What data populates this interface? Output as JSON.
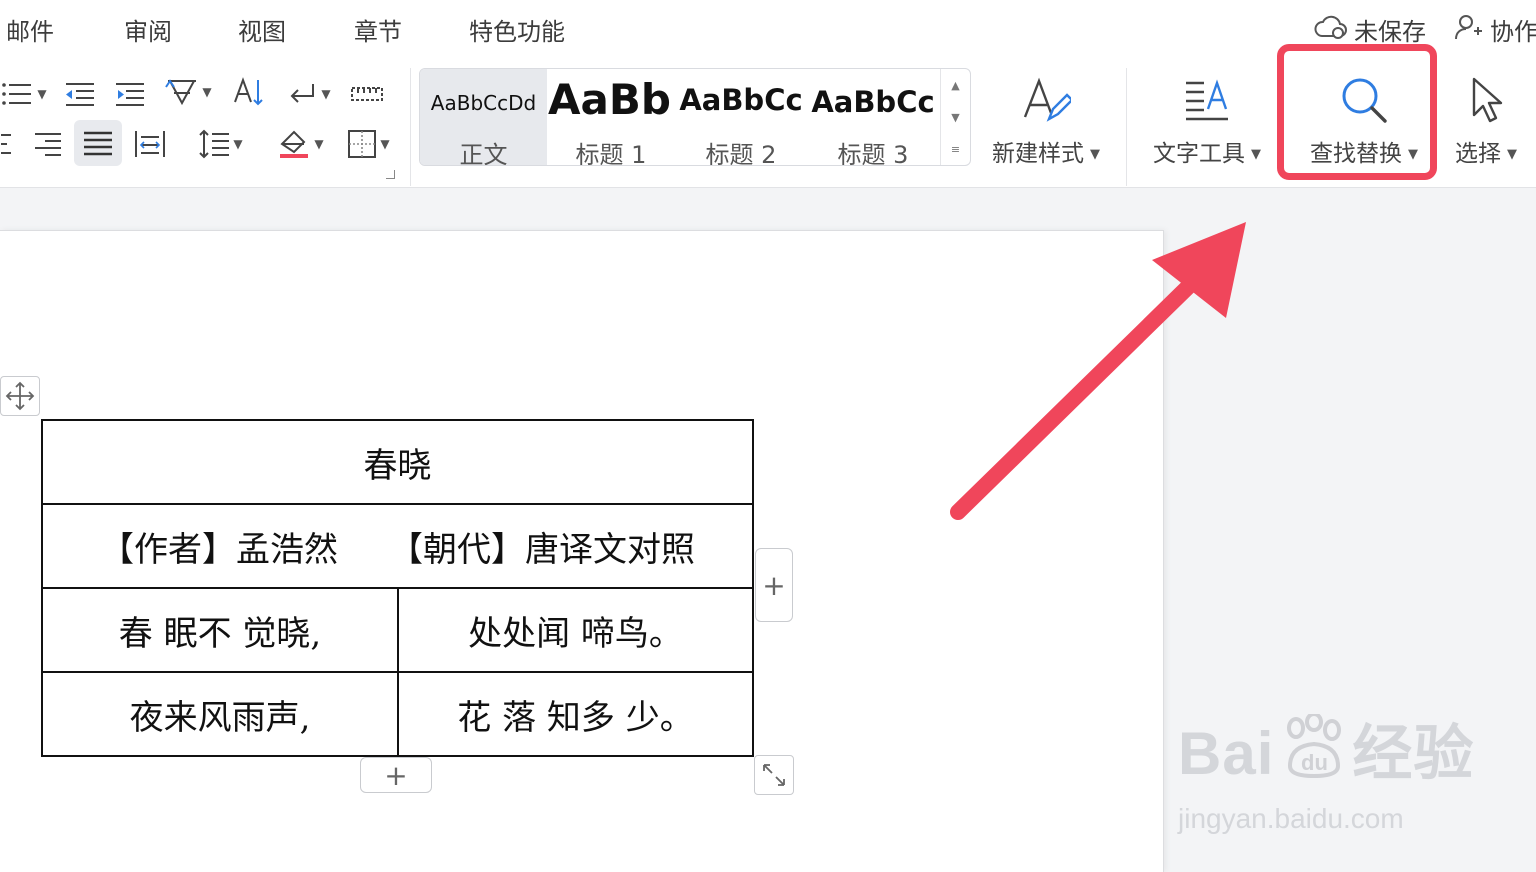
{
  "menu": {
    "tabs": [
      "邮件",
      "审阅",
      "视图",
      "章节",
      "特色功能"
    ],
    "unsaved": "未保存",
    "collab": "协作"
  },
  "styles": {
    "items": [
      {
        "preview": "AaBbCcDd",
        "label": "正文"
      },
      {
        "preview": "AaBb(",
        "label": "标题 1"
      },
      {
        "preview": "AaBbCc",
        "label": "标题 2"
      },
      {
        "preview": "AaBbCc",
        "label": "标题 3"
      }
    ]
  },
  "toolbar": {
    "new_style": "新建样式",
    "text_tools": "文字工具",
    "find_replace": "查找替换",
    "select": "选择"
  },
  "table": {
    "title": "春晓",
    "meta": "【作者】孟浩然　　【朝代】唐译文对照",
    "rows": [
      [
        "春 眠不 觉晓,",
        "处处闻 啼鸟。"
      ],
      [
        "夜来风雨声,",
        "花 落 知多 少。"
      ]
    ],
    "add": "+"
  },
  "watermark": {
    "brand": "Bai",
    "suffix": "经验",
    "url": "jingyan.baidu.com"
  },
  "colors": {
    "highlight": "#f0465b",
    "icon_blue": "#2f7de1"
  }
}
